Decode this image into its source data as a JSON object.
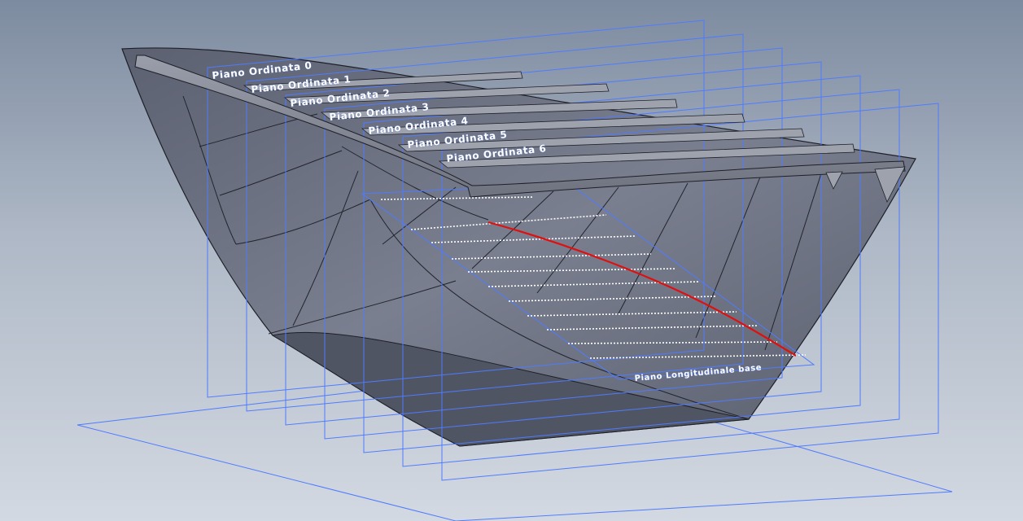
{
  "viewport": {
    "planes": [
      {
        "label": "Piano Ordinata 0"
      },
      {
        "label": "Piano Ordinata 1"
      },
      {
        "label": "Piano Ordinata 2"
      },
      {
        "label": "Piano Ordinata 3"
      },
      {
        "label": "Piano Ordinata 4"
      },
      {
        "label": "Piano Ordinata 5"
      },
      {
        "label": "Piano Ordinata 6"
      }
    ],
    "longitudinal_plane_label": "Piano Longitudinale base",
    "colors": {
      "hull": "#6e7383",
      "plane_outline": "#4f7bff",
      "section_curve": "#e01010",
      "background_top": "#7d8ba0",
      "background_bottom": "#d3d9e2"
    }
  }
}
